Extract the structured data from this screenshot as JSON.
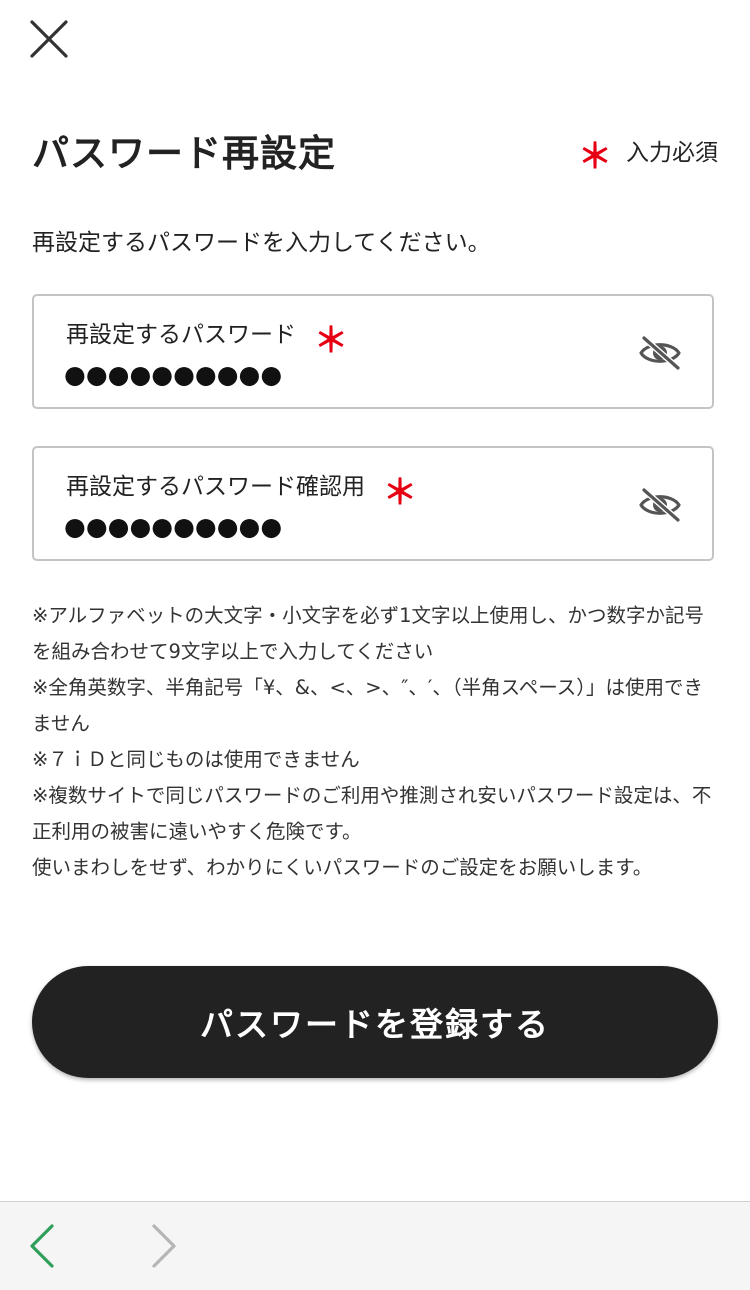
{
  "header": {
    "close_icon": "close-icon",
    "title": "パスワード再設定",
    "required_mark": "＊",
    "required_legend": "入力必須"
  },
  "intro": "再設定するパスワードを入力してください。",
  "fields": [
    {
      "label": "再設定するパスワード",
      "required_mark": "＊",
      "value": "●●●●●●●●●●",
      "toggle_icon": "eye-slash-icon"
    },
    {
      "label": "再設定するパスワード確認用",
      "required_mark": "＊",
      "value": "●●●●●●●●●●",
      "toggle_icon": "eye-slash-icon"
    }
  ],
  "notes": [
    "※アルファベットの大文字・小文字を必ず1文字以上使用し、かつ数字か記号を組み合わせて9文字以上で入力してください",
    "※全角英数字、半角記号「¥、&、<、>、″、′、（半角スペース）」は使用できません",
    "※７ｉＤと同じものは使用できません",
    "※複数サイトで同じパスワードのご利用や推測され安いパスワード設定は、不正利用の被害に遠いやすく危険です。",
    "使いまわしをせず、わかりにくいパスワードのご設定をお願いします。"
  ],
  "submit_label": "パスワードを登録する",
  "bottom_nav": {
    "back_icon": "chevron-left-icon",
    "forward_icon": "chevron-right-icon",
    "back_color": "#2e9e5b",
    "forward_color": "#b5b5b5"
  },
  "colors": {
    "required": "#e60012",
    "button_bg": "#222222",
    "border": "#c4c4c4"
  }
}
